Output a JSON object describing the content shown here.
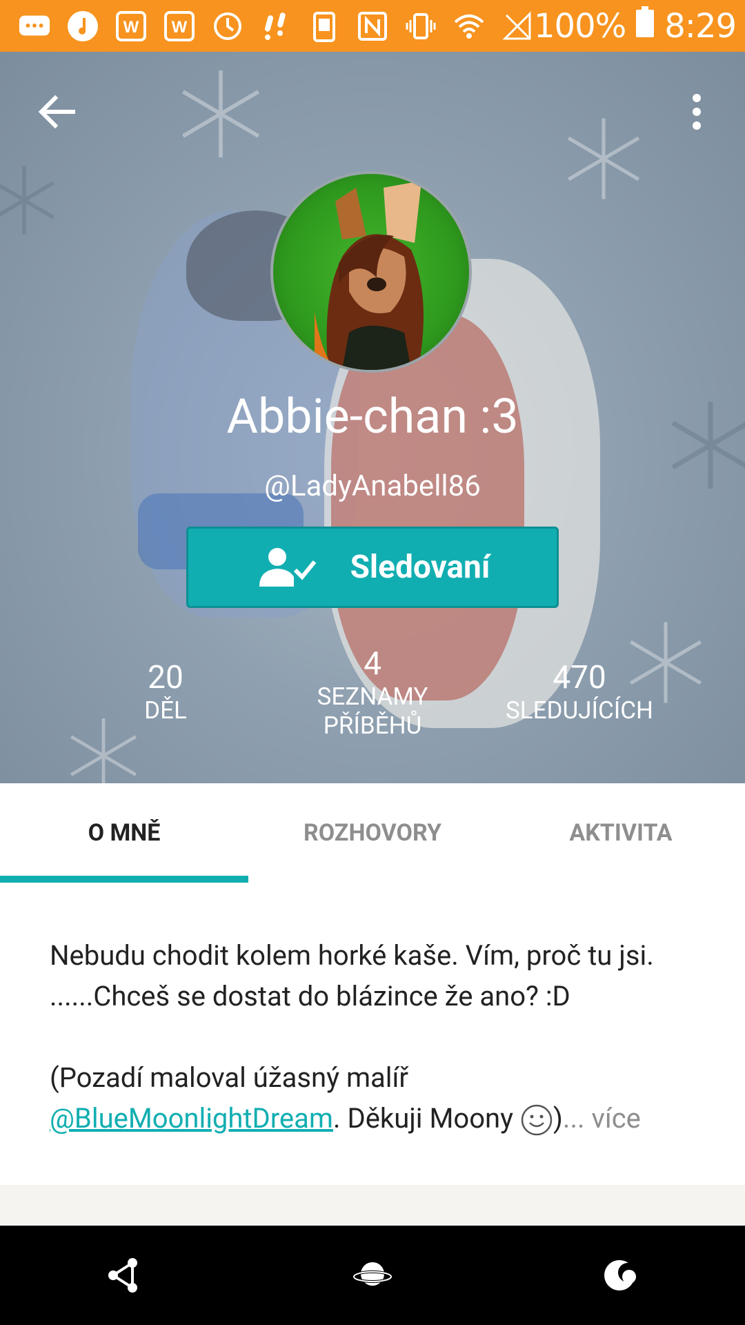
{
  "status_bar": {
    "battery": "100%",
    "time": "8:29",
    "icons": [
      "message-icon",
      "music-icon",
      "wattpad-icon",
      "wattpad-icon",
      "clock-icon",
      "voicemail-icon",
      "phone-sync-icon",
      "nfc-icon",
      "vibrate-icon",
      "wifi-icon",
      "signal-icon",
      "battery-icon"
    ]
  },
  "header": {
    "back_icon": "arrow-left-icon",
    "menu_icon": "more-vert-icon",
    "display_name": "Abbie-chan :3",
    "username": "@LadyAnabell86",
    "follow_button": {
      "label": "Sledovaní",
      "icon": "person-check-icon",
      "color": "#11aeb1"
    },
    "stats": [
      {
        "value": "20",
        "label_lines": [
          "DĚL"
        ]
      },
      {
        "value": "4",
        "label_lines": [
          "SEZNAMY",
          "PŘÍBĚHŮ"
        ]
      },
      {
        "value": "470",
        "label_lines": [
          "SLEDUJÍCÍCH"
        ]
      }
    ]
  },
  "tabs": [
    {
      "label": "O MNĚ",
      "active": true
    },
    {
      "label": "ROZHOVORY",
      "active": false
    },
    {
      "label": "AKTIVITA",
      "active": false
    }
  ],
  "about": {
    "paragraph1": "Nebudu chodit kolem horké kaše. Vím, proč tu jsi. ......Chceš se dostat do blázince že ano? :D",
    "paragraph2_prefix": "(Pozadí maloval úžasný malíř ",
    "mention": "@BlueMoonlightDream",
    "paragraph2_suffix": ". Děkuji Moony ",
    "paragraph2_end": ")",
    "more": "... více"
  },
  "bottom_nav": {
    "icons": [
      "share-icon",
      "planet-icon",
      "night-mode-icon"
    ]
  },
  "colors": {
    "accent": "#11aeb1",
    "status_bar": "#f7931e"
  }
}
